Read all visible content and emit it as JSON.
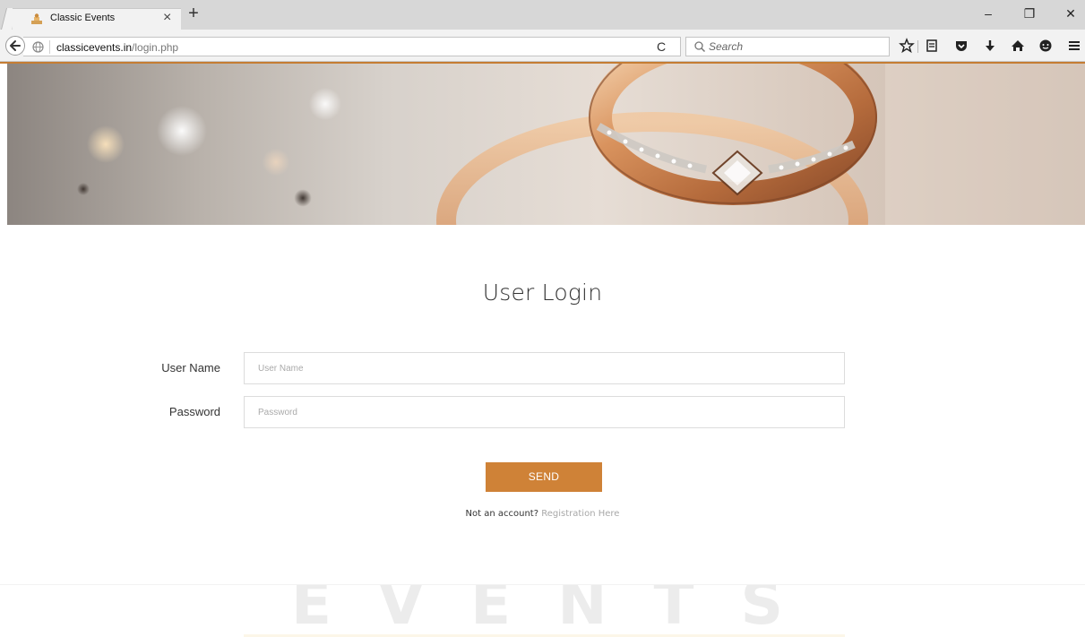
{
  "browser": {
    "tab_title": "Classic Events",
    "tab_close": "×",
    "new_tab": "+",
    "window": {
      "minimize": "–",
      "restore": "❐",
      "close": "✕"
    },
    "url_host": "classicevents.in",
    "url_path": "/login.php",
    "reload": "C",
    "search_placeholder": "Search"
  },
  "page": {
    "title": "User Login",
    "username_label": "User Name",
    "username_placeholder": "User Name",
    "password_label": "Password",
    "password_placeholder": "Password",
    "send_label": "SEND",
    "register_question": "Not an account?",
    "register_link": "Registration Here",
    "watermark": "EVENTS"
  },
  "colors": {
    "accent": "#cf8237",
    "nav_accent": "#c57d33",
    "link": "#a8a8a8"
  }
}
